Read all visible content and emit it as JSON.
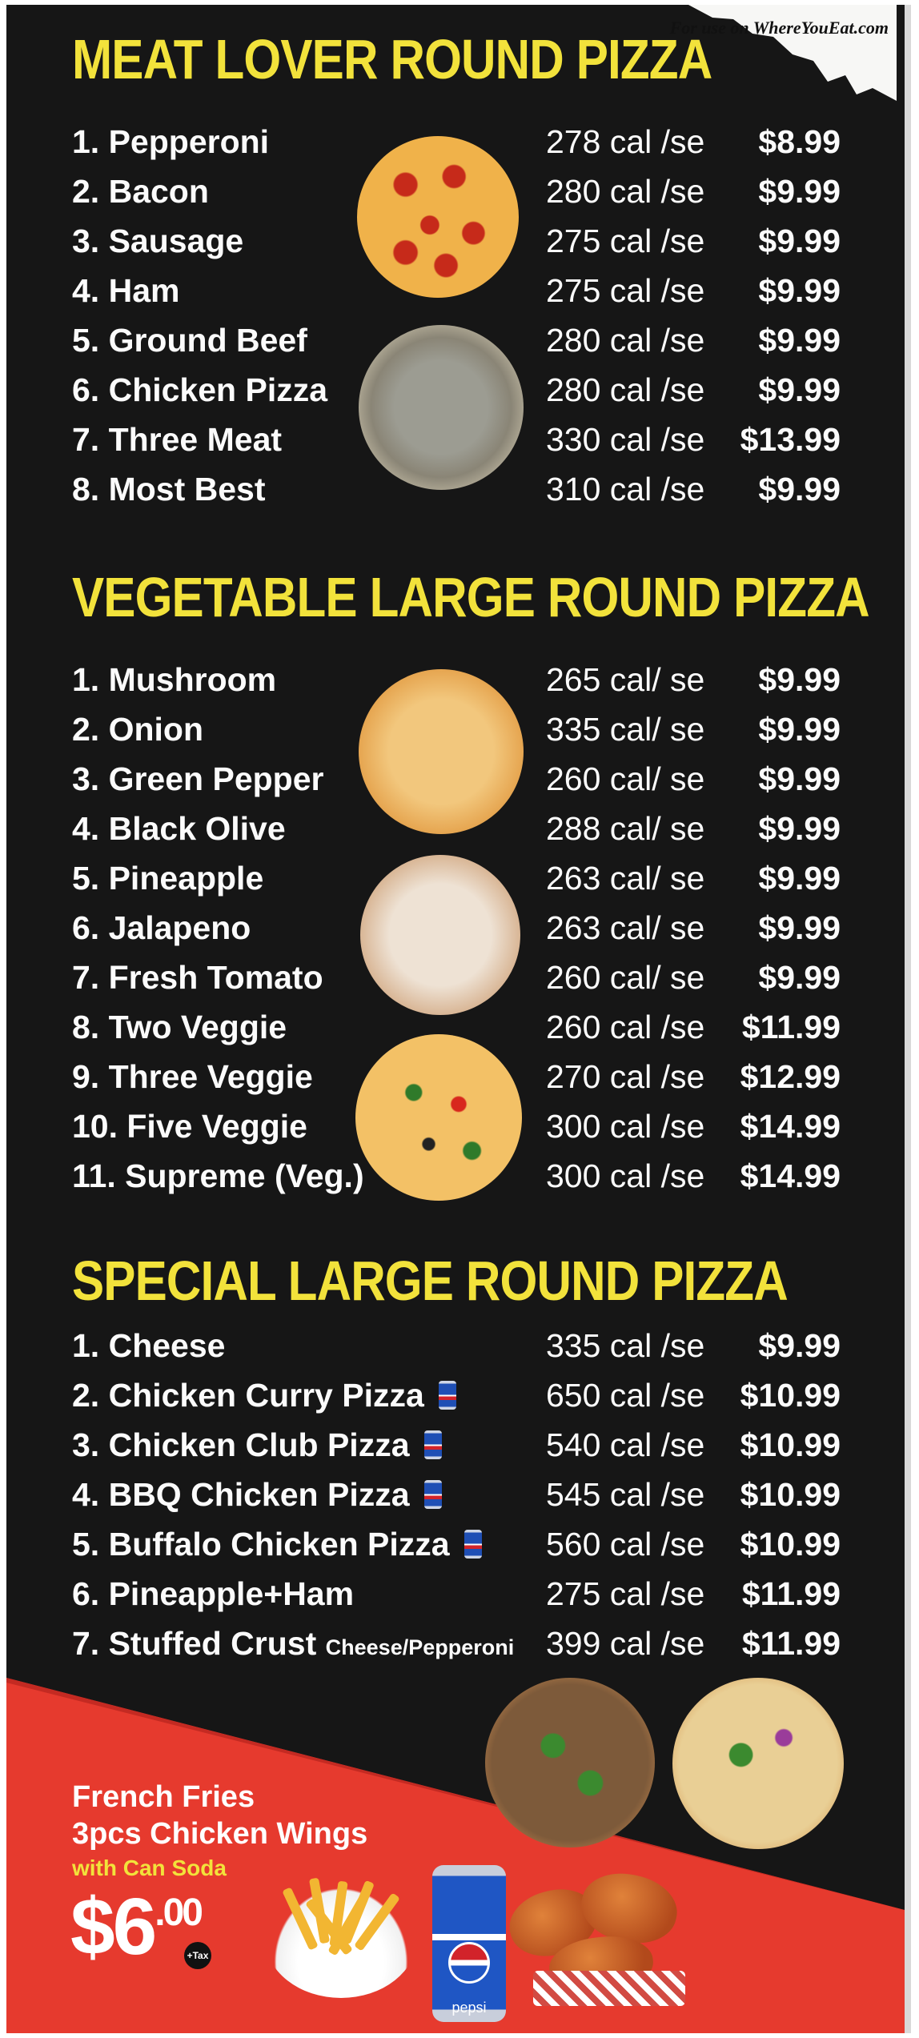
{
  "watermark": "For use on WhereYouEat.com",
  "sections": [
    {
      "heading": "MEAT LOVER ROUND PIZZA",
      "items": [
        {
          "name": "1. Pepperoni",
          "cal": "278 cal /se",
          "price": "$8.99"
        },
        {
          "name": "2. Bacon",
          "cal": "280 cal /se",
          "price": "$9.99"
        },
        {
          "name": "3. Sausage",
          "cal": "275 cal /se",
          "price": "$9.99"
        },
        {
          "name": "4. Ham",
          "cal": "275 cal /se",
          "price": "$9.99"
        },
        {
          "name": "5. Ground Beef",
          "cal": "280 cal /se",
          "price": "$9.99"
        },
        {
          "name": "6. Chicken Pizza",
          "cal": "280 cal /se",
          "price": "$9.99"
        },
        {
          "name": "7. Three Meat",
          "cal": "330 cal /se",
          "price": "$13.99"
        },
        {
          "name": "8. Most Best",
          "cal": "310 cal /se",
          "price": "$9.99"
        }
      ]
    },
    {
      "heading": "VEGETABLE LARGE ROUND PIZZA",
      "items": [
        {
          "name": "1. Mushroom",
          "cal": "265 cal/ se",
          "price": "$9.99"
        },
        {
          "name": "2. Onion",
          "cal": "335 cal/ se",
          "price": "$9.99"
        },
        {
          "name": "3. Green Pepper",
          "cal": "260 cal/ se",
          "price": "$9.99"
        },
        {
          "name": "4. Black Olive",
          "cal": "288 cal/ se",
          "price": "$9.99"
        },
        {
          "name": "5. Pineapple",
          "cal": "263 cal/ se",
          "price": "$9.99"
        },
        {
          "name": "6. Jalapeno",
          "cal": "263 cal/ se",
          "price": "$9.99"
        },
        {
          "name": "7. Fresh Tomato",
          "cal": "260 cal/ se",
          "price": "$9.99"
        },
        {
          "name": "8. Two Veggie",
          "cal": "260 cal /se",
          "price": "$11.99"
        },
        {
          "name": "9. Three Veggie",
          "cal": "270 cal /se",
          "price": "$12.99"
        },
        {
          "name": "10. Five Veggie",
          "cal": "300 cal /se",
          "price": "$14.99"
        },
        {
          "name": "11. Supreme (Veg.)",
          "cal": "300 cal /se",
          "price": "$14.99"
        }
      ]
    },
    {
      "heading": "SPECIAL LARGE ROUND PIZZA",
      "items": [
        {
          "name": "1. Cheese",
          "cal": "335 cal /se",
          "price": "$9.99"
        },
        {
          "name": "2. Chicken Curry Pizza",
          "cal": "650 cal /se",
          "price": "$10.99"
        },
        {
          "name": "3. Chicken Club Pizza",
          "cal": "540 cal /se",
          "price": "$10.99"
        },
        {
          "name": "4. BBQ Chicken Pizza",
          "cal": "545 cal /se",
          "price": "$10.99"
        },
        {
          "name": "5. Buffalo Chicken Pizza",
          "cal": "560 cal /se",
          "price": "$10.99"
        },
        {
          "name": "6. Pineapple+Ham",
          "cal": "275 cal /se",
          "price": "$11.99"
        },
        {
          "name": "7. Stuffed Crust",
          "name_suffix": "Cheese/Pepperoni",
          "cal": "399 cal /se",
          "price": "$11.99"
        }
      ]
    }
  ],
  "promo": {
    "line1": "French Fries",
    "line2": "3pcs Chicken Wings",
    "line3": "with Can Soda",
    "price_dollars": "$6",
    "price_cents": ".00",
    "tax_note": "+Tax",
    "can_brand": "pepsi"
  },
  "colors": {
    "background": "#161616",
    "heading": "#f2e23b",
    "text": "#fbfbfb",
    "promo_red": "#e63a2e"
  }
}
